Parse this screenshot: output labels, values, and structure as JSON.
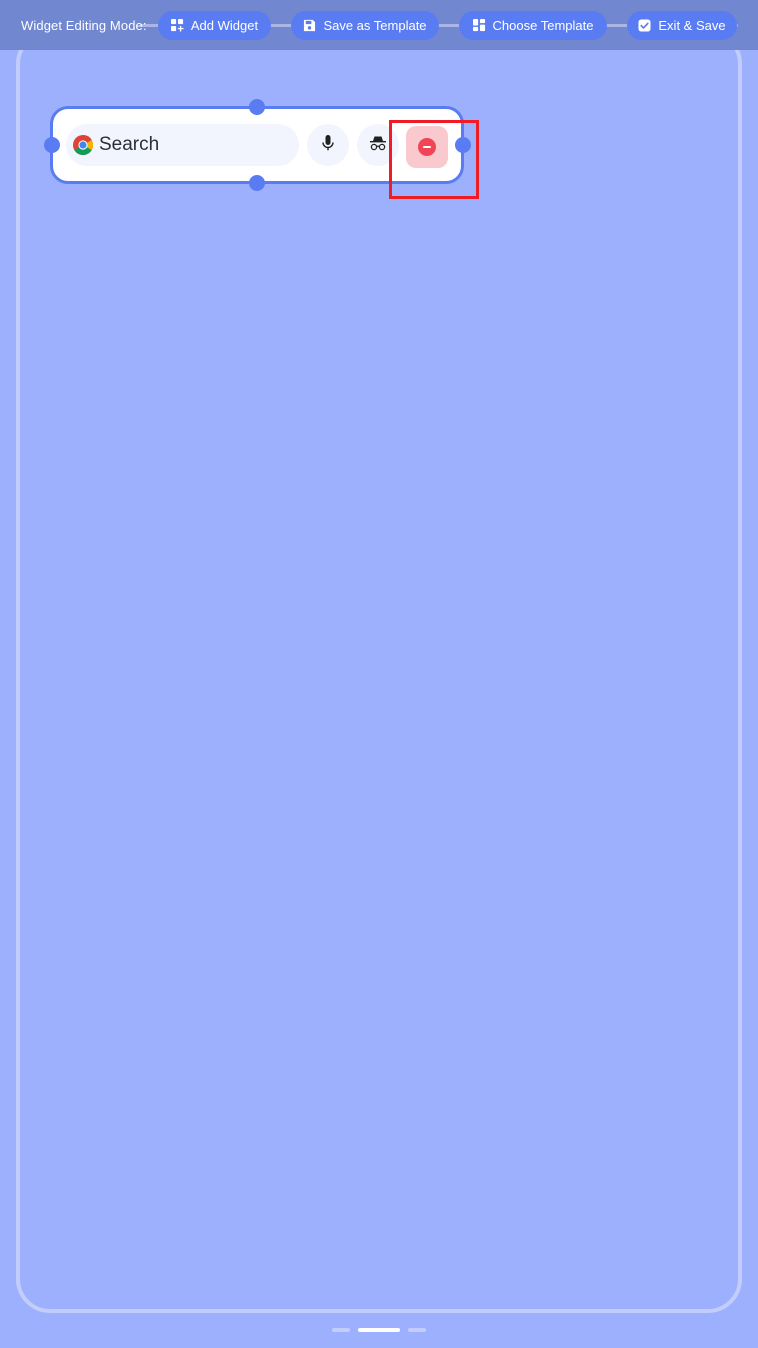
{
  "toolbar": {
    "title": "Widget Editing Mode:",
    "buttons": {
      "add_widget": "Add Widget",
      "save_as_template": "Save as Template",
      "choose_template": "Choose Template",
      "exit_save": "Exit & Save"
    }
  },
  "widget": {
    "search_placeholder": "Search",
    "icons": [
      "chrome-icon",
      "microphone-icon",
      "incognito-icon",
      "remove-icon"
    ]
  },
  "pager": {
    "page_count": 3,
    "active_index": 1
  },
  "colors": {
    "background": "#9db0fd",
    "accent": "#5a7cf2",
    "toolbar": "#7187cf",
    "remove_red": "#f04556",
    "highlight": "#ee1c24"
  }
}
